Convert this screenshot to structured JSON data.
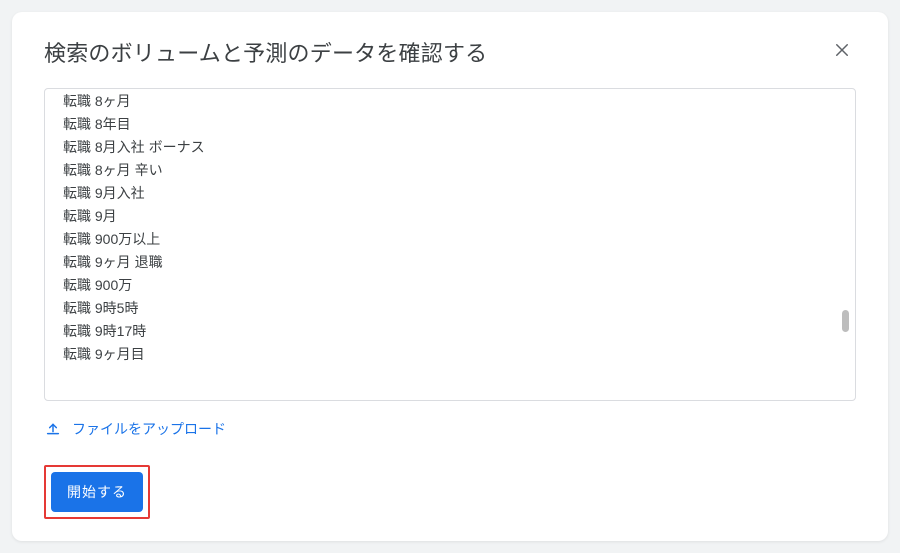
{
  "modal": {
    "title": "検索のボリュームと予測のデータを確認する",
    "keywords": {
      "line_cut_top": "転職 8ヶ月",
      "line1": "転職 8年目",
      "line2": "転職 8月入社 ボーナス",
      "line3": "転職 8ヶ月 辛い",
      "line4": "転職 9月入社",
      "line5": "転職 9月",
      "line6": "転職 900万以上",
      "line7": "転職 9ヶ月 退職",
      "line8": "転職 900万",
      "line9": "転職 9時5時",
      "line10": "転職 9時17時",
      "line11": "転職 9ヶ月目"
    },
    "upload_label": "ファイルをアップロード",
    "start_label": "開始する"
  }
}
